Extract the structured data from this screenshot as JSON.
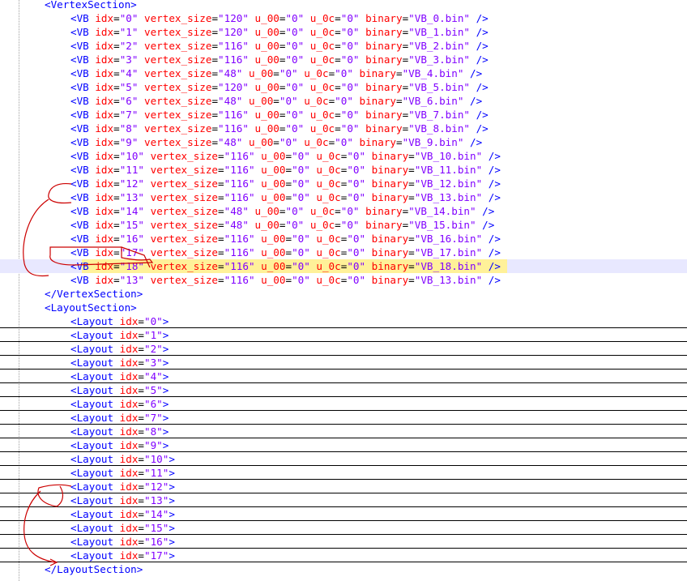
{
  "editor": {
    "lines": [
      {
        "kind": "tag",
        "name": "VertexSection"
      },
      {
        "kind": "vb",
        "idx": "0",
        "size": "120",
        "bin": "VB_0.bin"
      },
      {
        "kind": "vb",
        "idx": "1",
        "size": "120",
        "bin": "VB_1.bin"
      },
      {
        "kind": "vb",
        "idx": "2",
        "size": "116",
        "bin": "VB_2.bin"
      },
      {
        "kind": "vb",
        "idx": "3",
        "size": "116",
        "bin": "VB_3.bin"
      },
      {
        "kind": "vb",
        "idx": "4",
        "size": "48",
        "bin": "VB_4.bin"
      },
      {
        "kind": "vb",
        "idx": "5",
        "size": "120",
        "bin": "VB_5.bin"
      },
      {
        "kind": "vb",
        "idx": "6",
        "size": "48",
        "bin": "VB_6.bin"
      },
      {
        "kind": "vb",
        "idx": "7",
        "size": "116",
        "bin": "VB_7.bin"
      },
      {
        "kind": "vb",
        "idx": "8",
        "size": "116",
        "bin": "VB_8.bin"
      },
      {
        "kind": "vb",
        "idx": "9",
        "size": "48",
        "bin": "VB_9.bin"
      },
      {
        "kind": "vb",
        "idx": "10",
        "size": "116",
        "bin": "VB_10.bin"
      },
      {
        "kind": "vb",
        "idx": "11",
        "size": "116",
        "bin": "VB_11.bin"
      },
      {
        "kind": "vb",
        "idx": "12",
        "size": "116",
        "bin": "VB_12.bin"
      },
      {
        "kind": "vb",
        "idx": "13",
        "size": "116",
        "bin": "VB_13.bin"
      },
      {
        "kind": "vb",
        "idx": "14",
        "size": "48",
        "bin": "VB_14.bin"
      },
      {
        "kind": "vb",
        "idx": "15",
        "size": "48",
        "bin": "VB_15.bin"
      },
      {
        "kind": "vb",
        "idx": "16",
        "size": "116",
        "bin": "VB_16.bin"
      },
      {
        "kind": "vb",
        "idx": "17",
        "size": "116",
        "bin": "VB_17.bin"
      },
      {
        "kind": "vb",
        "idx": "18",
        "size": "116",
        "bin": "VB_18.bin",
        "current": true
      },
      {
        "kind": "vb",
        "idx": "13",
        "size": "116",
        "bin": "VB_13.bin"
      },
      {
        "kind": "close",
        "name": "VertexSection"
      },
      {
        "kind": "tag",
        "name": "LayoutSection"
      },
      {
        "kind": "layout",
        "idx": "0"
      },
      {
        "kind": "layout",
        "idx": "1"
      },
      {
        "kind": "layout",
        "idx": "2"
      },
      {
        "kind": "layout",
        "idx": "3"
      },
      {
        "kind": "layout",
        "idx": "4"
      },
      {
        "kind": "layout",
        "idx": "5"
      },
      {
        "kind": "layout",
        "idx": "6"
      },
      {
        "kind": "layout",
        "idx": "7"
      },
      {
        "kind": "layout",
        "idx": "8"
      },
      {
        "kind": "layout",
        "idx": "9"
      },
      {
        "kind": "layout",
        "idx": "10"
      },
      {
        "kind": "layout",
        "idx": "11"
      },
      {
        "kind": "layout",
        "idx": "12"
      },
      {
        "kind": "layout",
        "idx": "13"
      },
      {
        "kind": "layout",
        "idx": "14"
      },
      {
        "kind": "layout",
        "idx": "15"
      },
      {
        "kind": "layout",
        "idx": "16"
      },
      {
        "kind": "layout",
        "idx": "17"
      },
      {
        "kind": "close",
        "name": "LayoutSection"
      }
    ],
    "vb_tag": "VB",
    "layout_tag": "Layout",
    "attr_idx": "idx",
    "attr_size": "vertex_size",
    "attr_u00": "u_00",
    "attr_u0c": "u_0c",
    "attr_bin": "binary",
    "val_u00": "0",
    "val_u0c": "0"
  },
  "colors": {
    "tag": "#0000ff",
    "attr": "#ff0000",
    "value": "#8000ff",
    "annotation": "#cc0000",
    "current_line": "#e8e8ff",
    "highlight": "#fff199"
  }
}
